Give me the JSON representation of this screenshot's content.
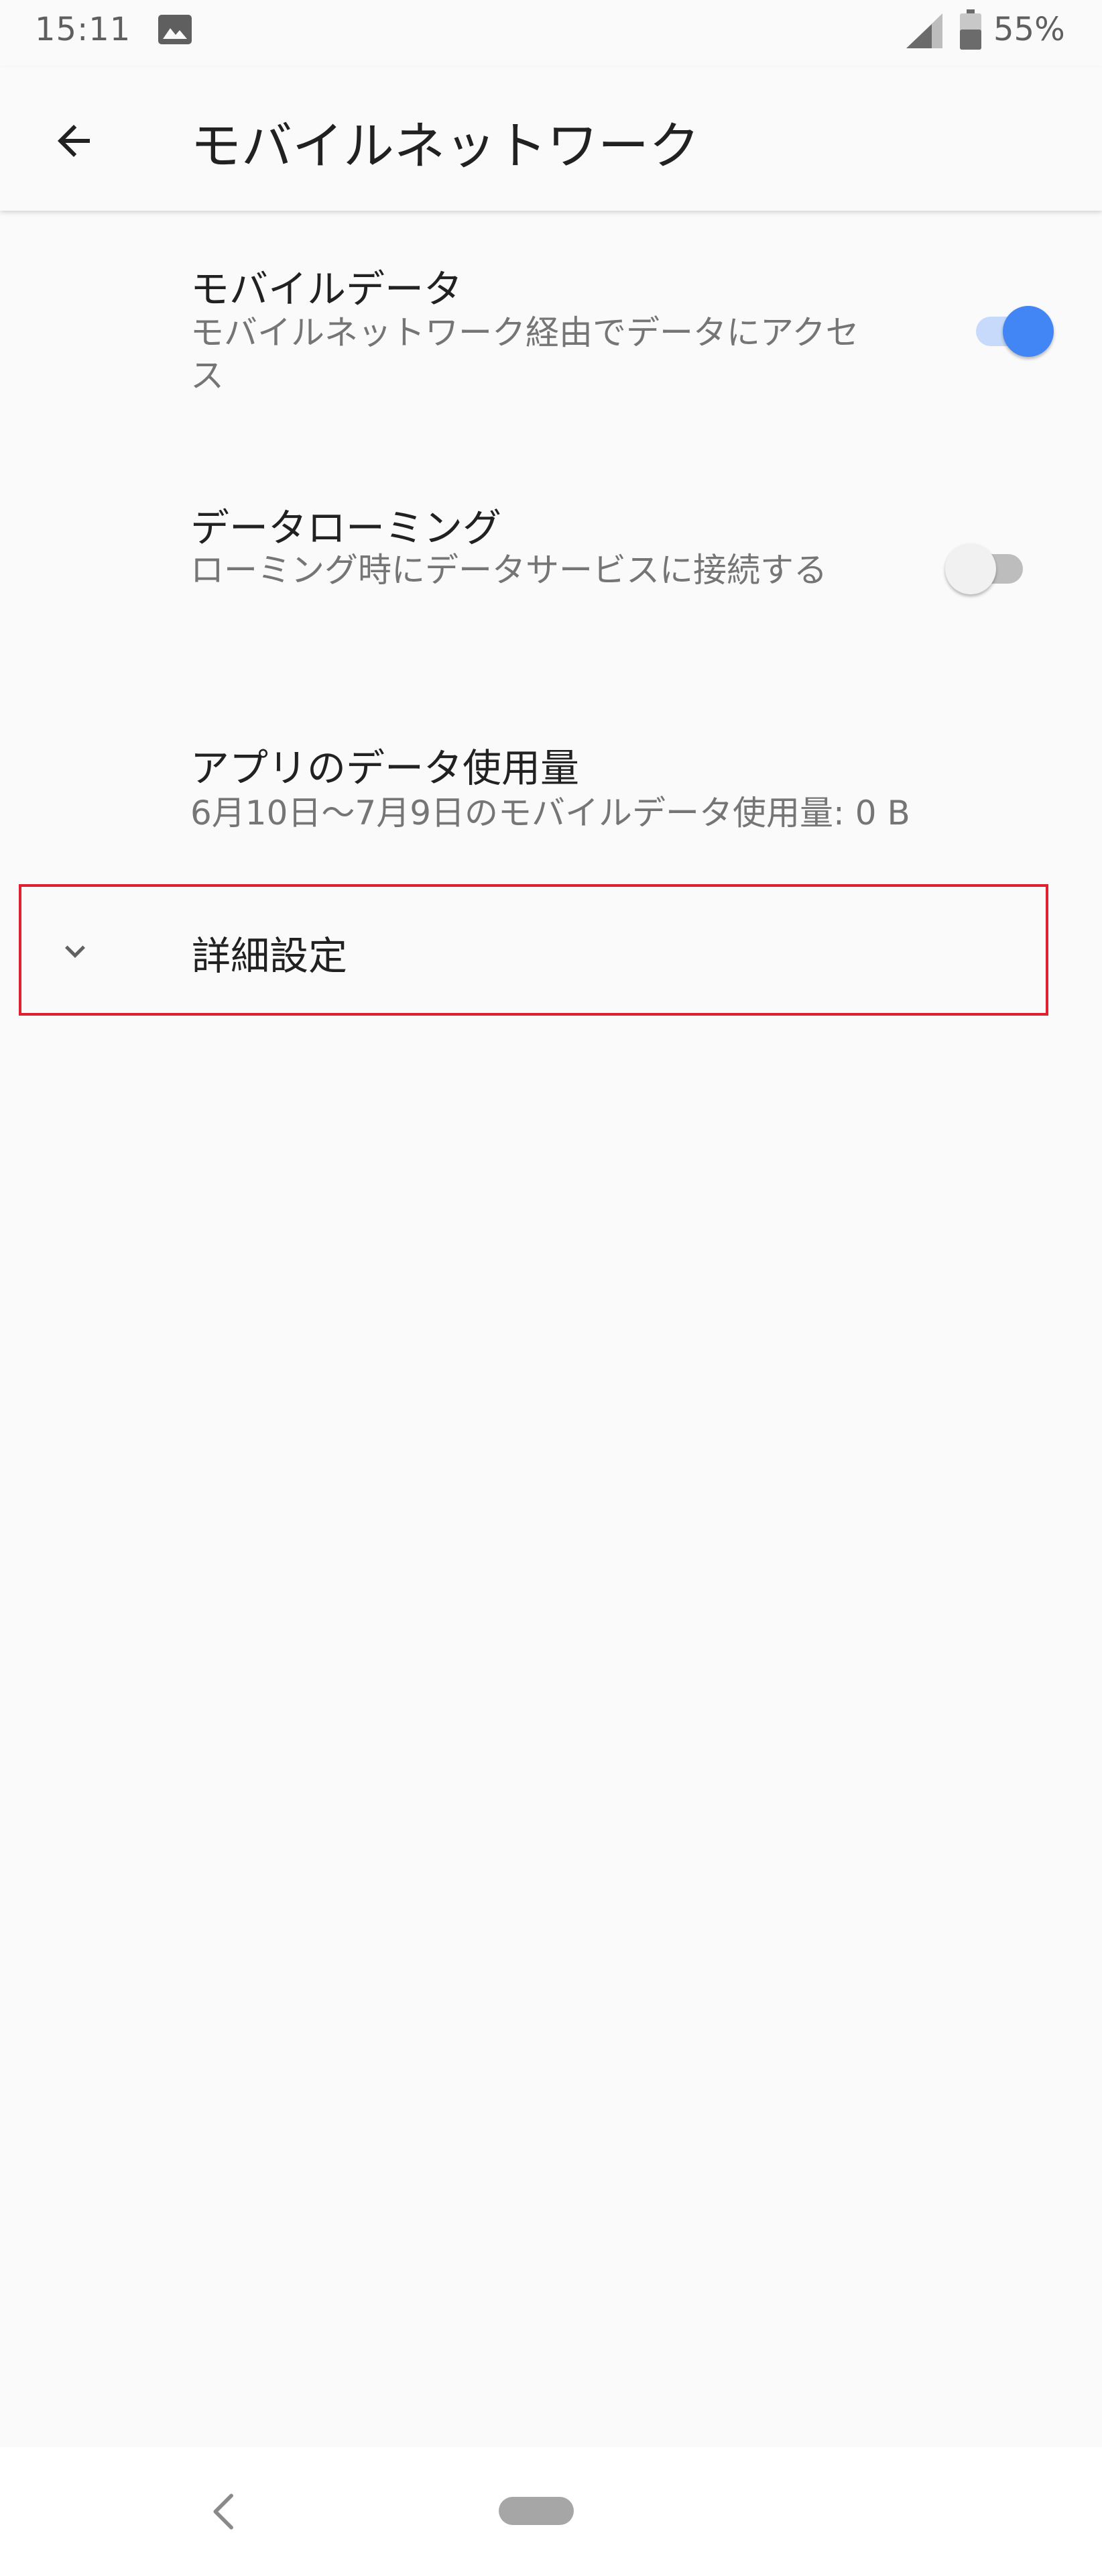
{
  "status_bar": {
    "time": "15:11",
    "battery": "55%",
    "icons": [
      "image-icon",
      "signal-icon",
      "battery-icon"
    ]
  },
  "app_bar": {
    "title": "モバイルネットワーク",
    "back_icon": "arrow-back-icon"
  },
  "preferences": [
    {
      "title": "モバイルデータ",
      "summary": "モバイルネットワーク経由でデータにアクセス",
      "switch_on": true
    },
    {
      "title": "データローミング",
      "summary": "ローミング時にデータサービスに接続する",
      "switch_on": false
    },
    {
      "title": "アプリのデータ使用量",
      "summary": "6月10日〜7月9日のモバイルデータ使用量: 0 B"
    }
  ],
  "advanced": {
    "label": "詳細設定",
    "icon": "chevron-down-icon",
    "highlight_color": "#e0202f"
  },
  "nav_bar": {
    "icons": [
      "nav-back-icon",
      "home-pill-icon"
    ]
  },
  "colors": {
    "accent": "#4285f4",
    "background": "#fafafa",
    "text_primary": "#212121",
    "text_secondary": "#757575"
  }
}
